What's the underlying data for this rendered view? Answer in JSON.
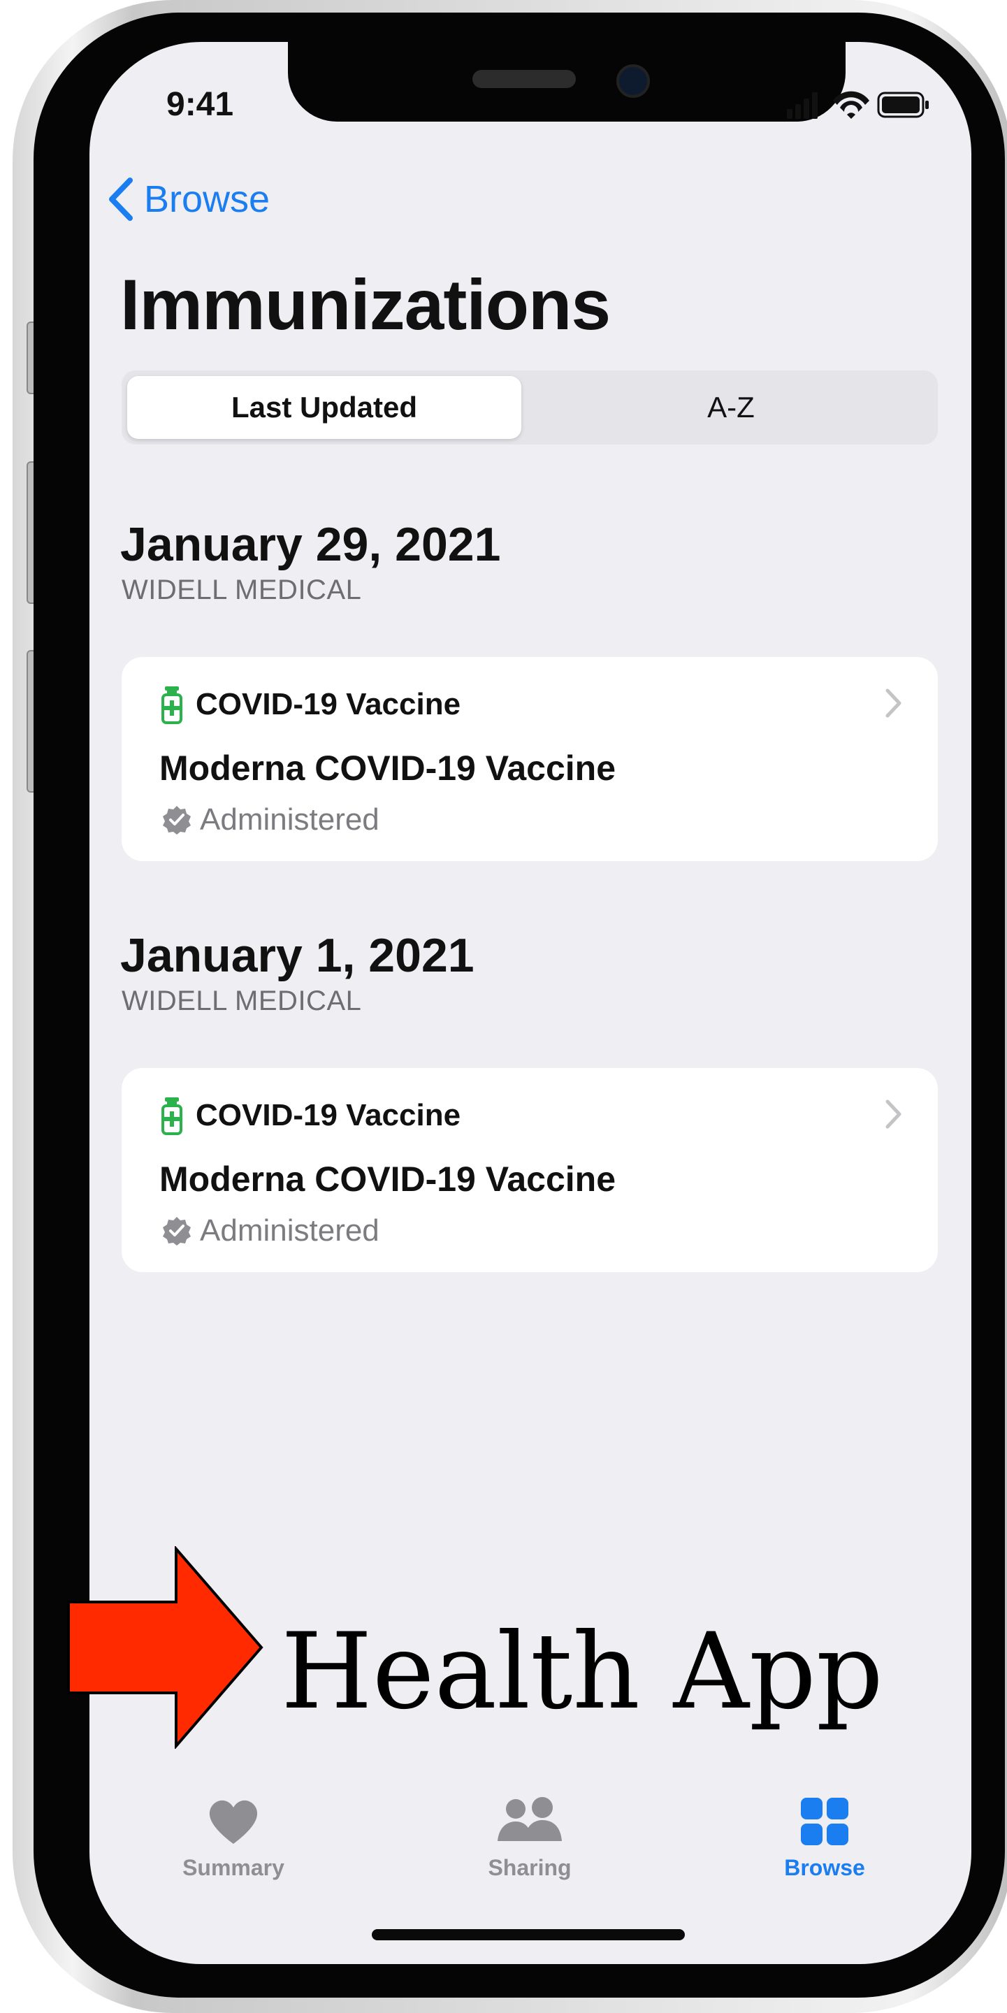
{
  "status_bar": {
    "time": "9:41"
  },
  "navigation": {
    "back_label": "Browse"
  },
  "page": {
    "title": "Immunizations"
  },
  "segmented_control": {
    "options": [
      "Last Updated",
      "A-Z"
    ],
    "selected": "Last Updated"
  },
  "sections": [
    {
      "date": "January 29, 2021",
      "source": "WIDELL MEDICAL",
      "record": {
        "type": "COVID-19 Vaccine",
        "name": "Moderna COVID-19 Vaccine",
        "status": "Administered"
      }
    },
    {
      "date": "January 1, 2021",
      "source": "WIDELL MEDICAL",
      "record": {
        "type": "COVID-19 Vaccine",
        "name": "Moderna COVID-19 Vaccine",
        "status": "Administered"
      }
    }
  ],
  "annotation": {
    "text": "Health App",
    "arrow_color": "#ff2a00"
  },
  "tab_bar": {
    "tabs": [
      {
        "label": "Summary",
        "icon": "heart-icon"
      },
      {
        "label": "Sharing",
        "icon": "people-icon"
      },
      {
        "label": "Browse",
        "icon": "grid-icon"
      }
    ],
    "active": "Browse"
  },
  "colors": {
    "accent": "#1a7df0",
    "vaccine_icon": "#2bb24c",
    "background": "#efeef3"
  }
}
